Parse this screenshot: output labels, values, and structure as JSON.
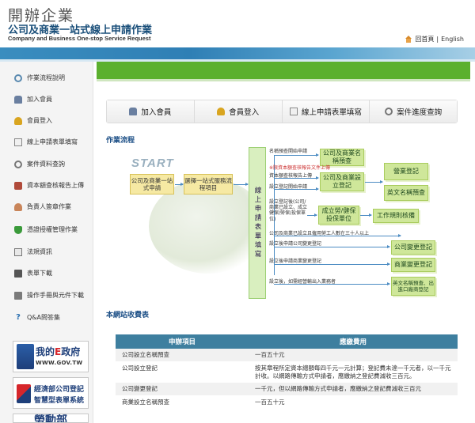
{
  "header": {
    "brand_cn": "開辦企業",
    "brand_sub": "公司及商業一站式線上申請作業",
    "brand_en": "Company and Business One-stop Service Request",
    "home_label": "回首頁",
    "separator": "|",
    "english_label": "English"
  },
  "sidebar": {
    "items": [
      {
        "label": "作業流程說明",
        "icon": "flow-icon"
      },
      {
        "label": "加入會員",
        "icon": "user-icon"
      },
      {
        "label": "會員登入",
        "icon": "key-icon"
      },
      {
        "label": "線上申請表單填寫",
        "icon": "document-icon"
      },
      {
        "label": "案件資料查詢",
        "icon": "search-icon"
      },
      {
        "label": "資本額查核報告上傳",
        "icon": "upload-icon"
      },
      {
        "label": "負責人簽章作業",
        "icon": "person-icon"
      },
      {
        "label": "憑證授權管理作業",
        "icon": "shield-icon"
      },
      {
        "label": "法規資訊",
        "icon": "law-icon"
      },
      {
        "label": "表單下載",
        "icon": "download-icon"
      },
      {
        "label": "操作手冊與元件下載",
        "icon": "manual-icon"
      },
      {
        "label": "Q&A問答集",
        "icon": "qa-icon"
      }
    ],
    "banners": {
      "gov_title_a": "我的",
      "gov_title_e": "E",
      "gov_title_b": "政府",
      "gov_url": "WWW.GOV.TW",
      "moea_line1": "經濟部公司登記",
      "moea_line2": "智慧型表單系統",
      "mol_title": "勞動部"
    }
  },
  "tabs": [
    {
      "label": "加入會員",
      "icon": "user-icon"
    },
    {
      "label": "會員登入",
      "icon": "key-icon"
    },
    {
      "label": "線上申請表單填寫",
      "icon": "document-icon"
    },
    {
      "label": "案件進度查詢",
      "icon": "search-icon"
    }
  ],
  "flow": {
    "section_title": "作業流程",
    "start": "START",
    "step1": "公司及商業一站式申請",
    "step2": "選擇一站式服務流程項目",
    "vertical": "線上申請表單填寫",
    "name_check": "公司及商業名稱預查",
    "register": "公司及商業設立登記",
    "business_reg": "營業登記",
    "english_name": "英文名稱預查",
    "insurance": "成立勞/健保投保單位",
    "work_rules": "工作規則核備",
    "change_reg": "公司變更登記",
    "biz_change": "商業變更登記",
    "english_final": "英文名稱預查、出進口廠商登記",
    "label1": "名稱預查開始申請",
    "label2": "※限資本額查核報告文件上傳",
    "label3": "資本額查核報告上傳",
    "label4": "設立登記開始申請",
    "label5": "設立登記後(公司/商業已設立、成立健保/勞保/投保單位)",
    "label6": "公司及商業已設立且僱用勞工人數在三十人以上",
    "label7": "設立後申請公司變更登記",
    "label8": "設立後申請商業變更登記",
    "label9": "設立後，如需經營輸出入業務者"
  },
  "fees": {
    "section_title": "本網站收費表",
    "columns": [
      "申辦項目",
      "應繳費用"
    ],
    "rows": [
      [
        "公司設立名稱預查",
        "一百五十元"
      ],
      [
        "公司設立登記",
        "按其章程所定資本總額每四千元一元計算；登記費未達一千元者，以一千元計收。以網路傳輸方式申請者，應繳納之登記費減收三百元。"
      ],
      [
        "公司變更登記",
        "一千元，但以網路傳輸方式申請者，應繳納之登記費減收三百元"
      ],
      [
        "商業設立名稱預查",
        "一百五十元"
      ]
    ]
  },
  "colors": {
    "green_bar": "#5bb02e",
    "banner_blue": "#2f7fb5",
    "table_header": "#3e7f9f",
    "section_title": "#1c4f86"
  }
}
